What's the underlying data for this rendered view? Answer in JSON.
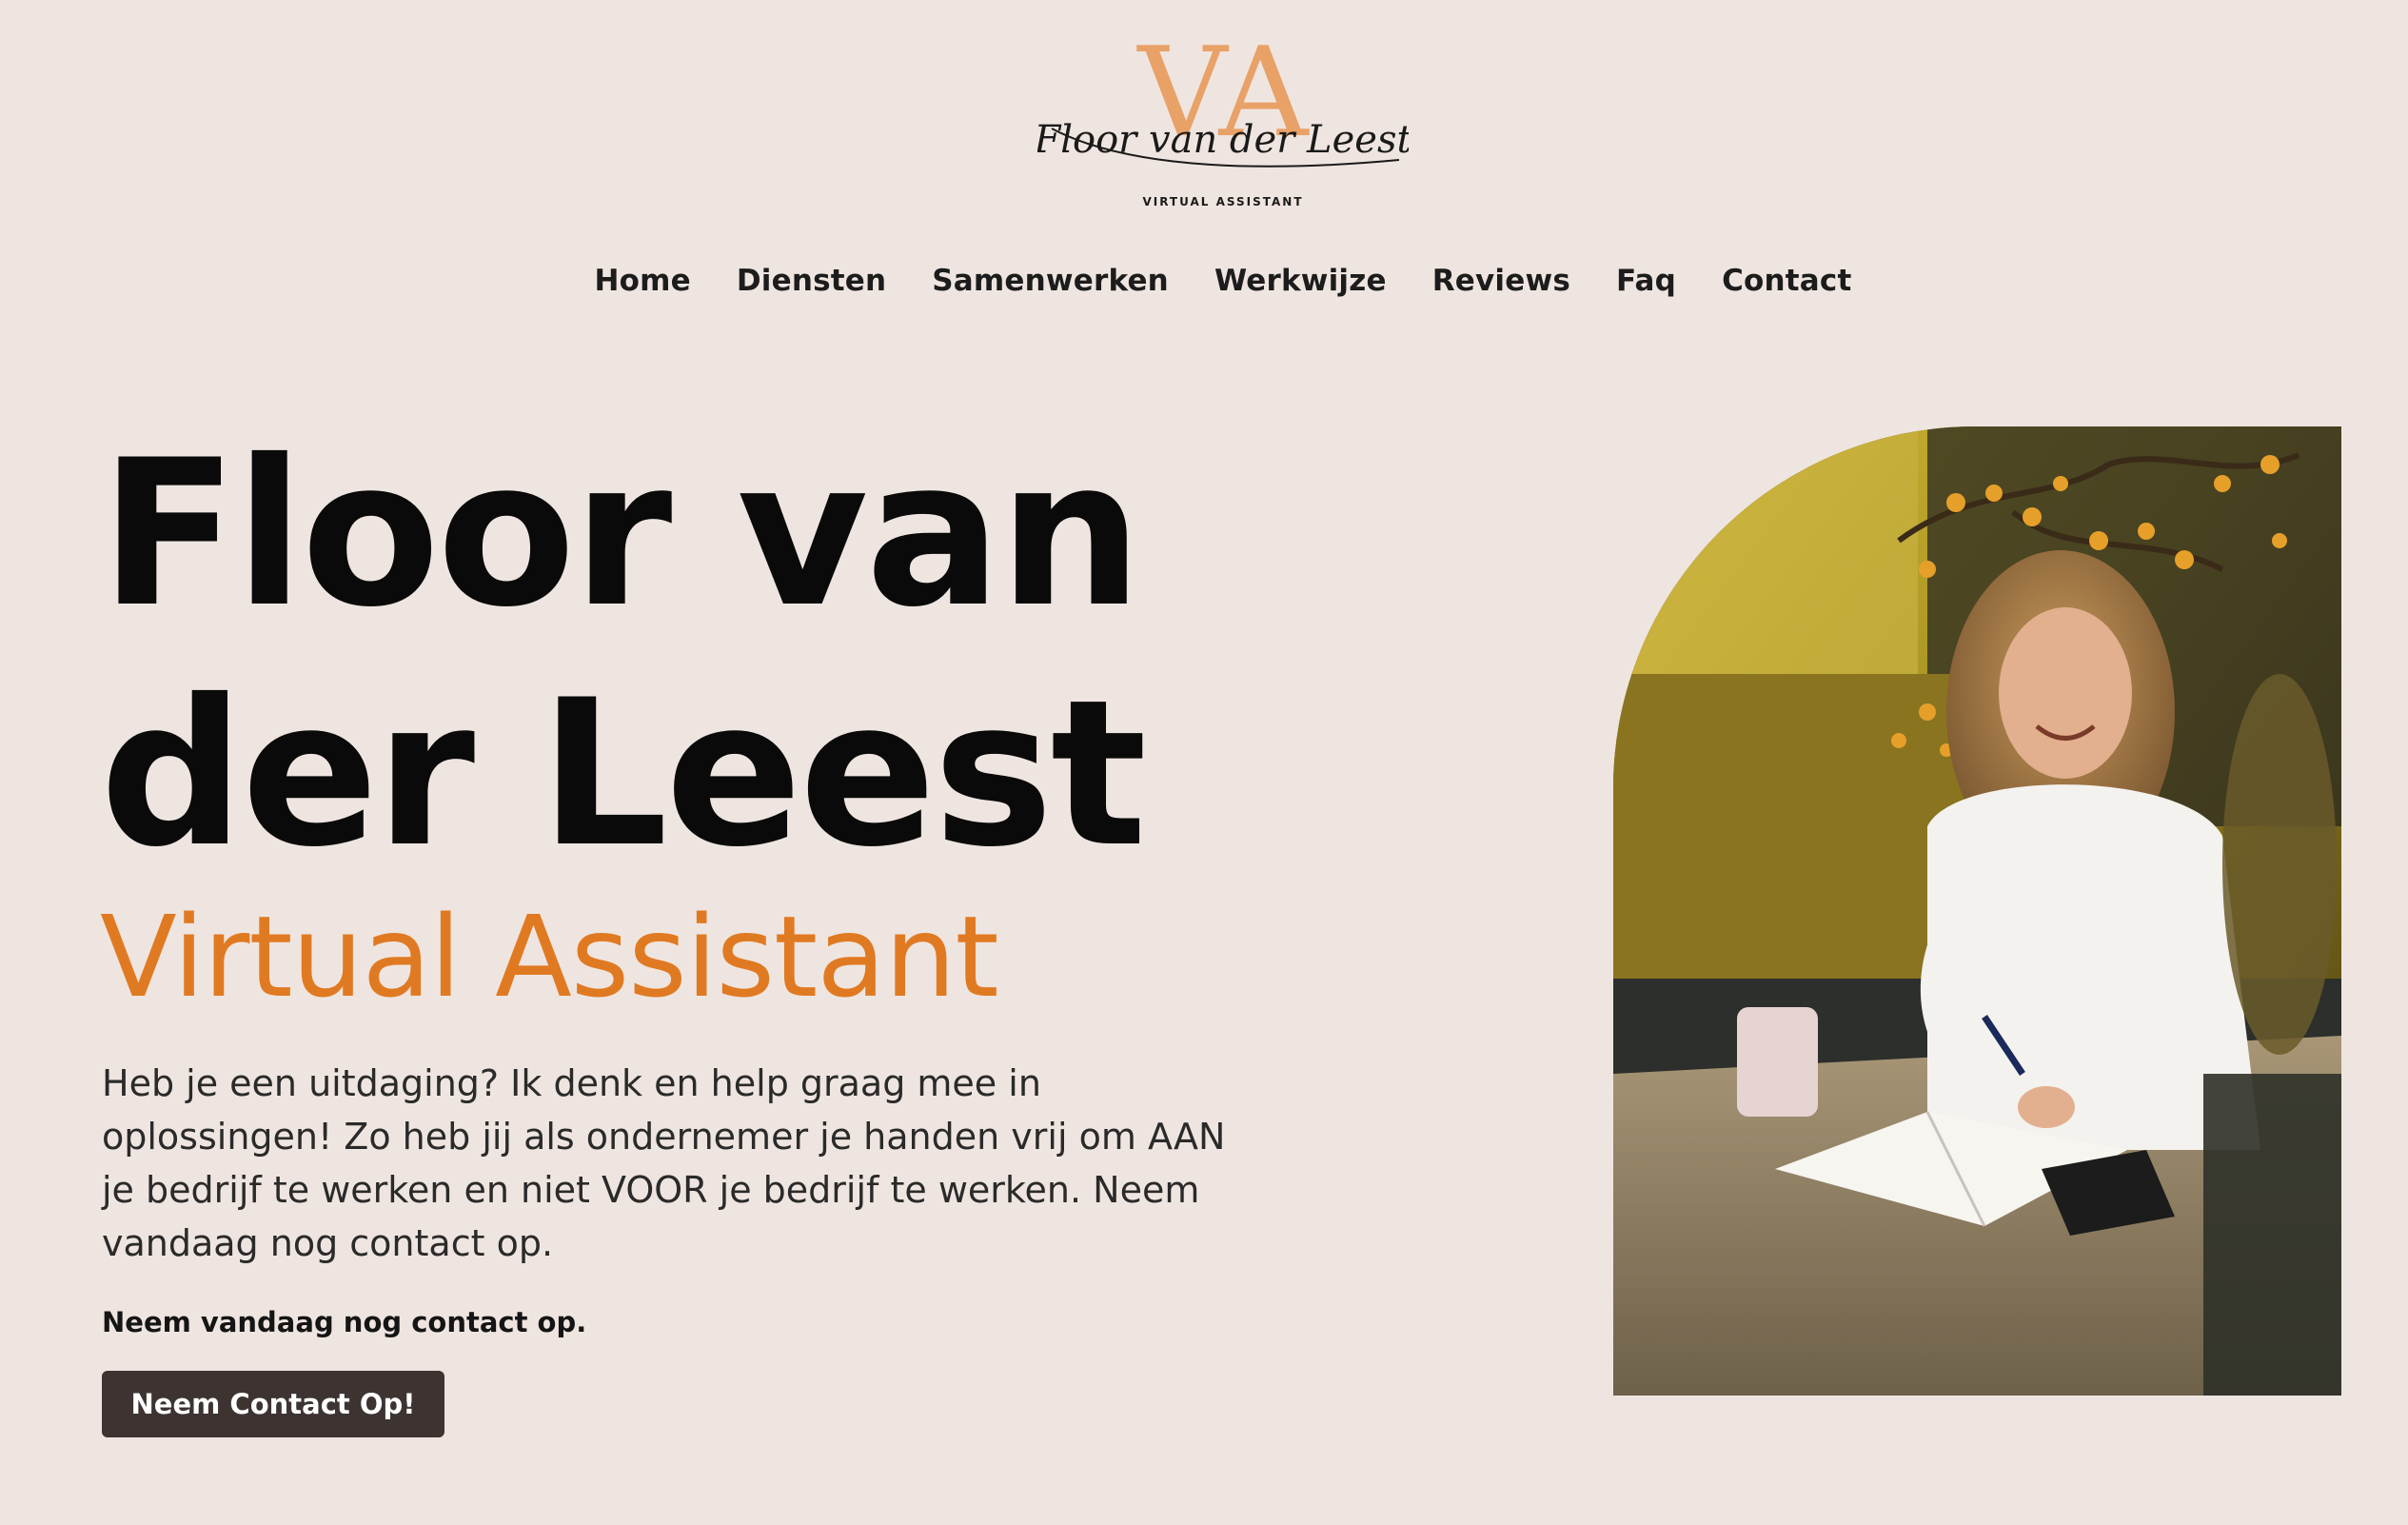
{
  "logo": {
    "monogram": "VA",
    "script_name": "Floor van der Leest",
    "tagline": "VIRTUAL ASSISTANT"
  },
  "nav": {
    "items": [
      {
        "label": "Home"
      },
      {
        "label": "Diensten"
      },
      {
        "label": "Samenwerken"
      },
      {
        "label": "Werkwijze"
      },
      {
        "label": "Reviews"
      },
      {
        "label": "Faq"
      },
      {
        "label": "Contact"
      }
    ]
  },
  "hero": {
    "title_line1": "Floor van",
    "title_line2": "der Leest",
    "subtitle": "Virtual Assistant",
    "description": "Heb je een uitdaging? Ik denk en help graag mee in oplossingen! Zo heb jij als ondernemer je handen vrij om AAN je bedrijf te werken en niet VOOR je bedrijf te werken. Neem vandaag nog contact op.",
    "cta_text": "Neem vandaag nog contact op.",
    "cta_button": "Neem Contact Op!"
  },
  "colors": {
    "background": "#efe5e0",
    "accent_orange": "#e07a22",
    "button_bg": "#3d3432",
    "text_dark": "#0a0a0a"
  },
  "images": {
    "hero_photo": "woman-writing-in-notebook-at-kitchen-counter"
  }
}
